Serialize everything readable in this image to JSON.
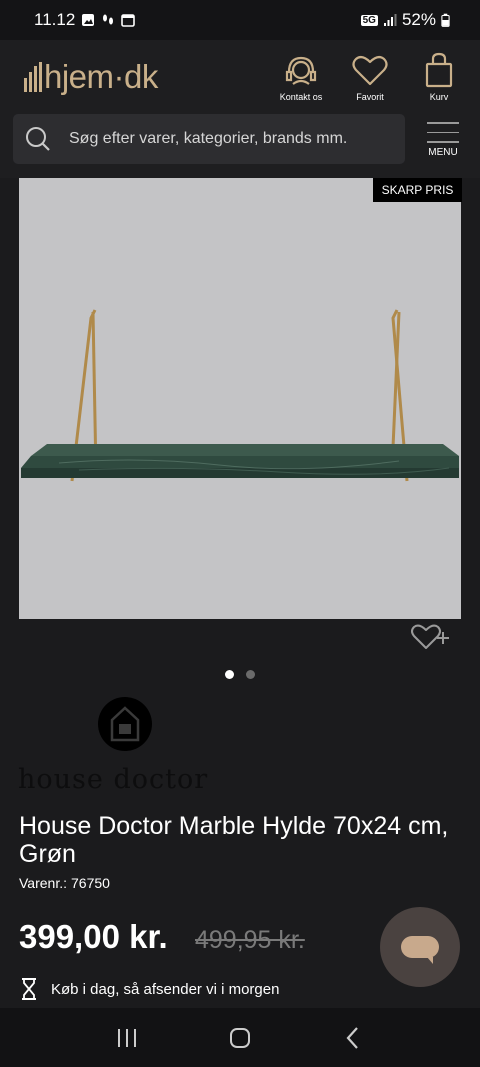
{
  "status_bar": {
    "time": "11.12",
    "network": "5G",
    "battery": "52%"
  },
  "header": {
    "logo_text": "hjem·dk",
    "contact_label": "Kontakt os",
    "favorite_label": "Favorit",
    "cart_label": "Kurv",
    "menu_label": "MENU"
  },
  "search": {
    "placeholder": "Søg efter varer, kategorier, brands mm."
  },
  "product": {
    "badge": "SKARP PRIS",
    "brand": "house doctor",
    "title": "House Doctor Marble Hylde 70x24 cm, Grøn",
    "sku_label": "Varenr.:",
    "sku": "76750",
    "price": "399,00 kr.",
    "old_price": "499,95 kr.",
    "delivery_text": "Køb i dag, så afsender vi i morgen",
    "image_count": 2,
    "active_image": 1
  },
  "colors": {
    "accent": "#c9b08a",
    "background": "#1b1b1d"
  },
  "icons": [
    "headset-icon",
    "heart-icon",
    "bag-icon",
    "search-icon",
    "hamburger-icon",
    "heart-plus-icon",
    "hourglass-icon",
    "chat-icon"
  ]
}
